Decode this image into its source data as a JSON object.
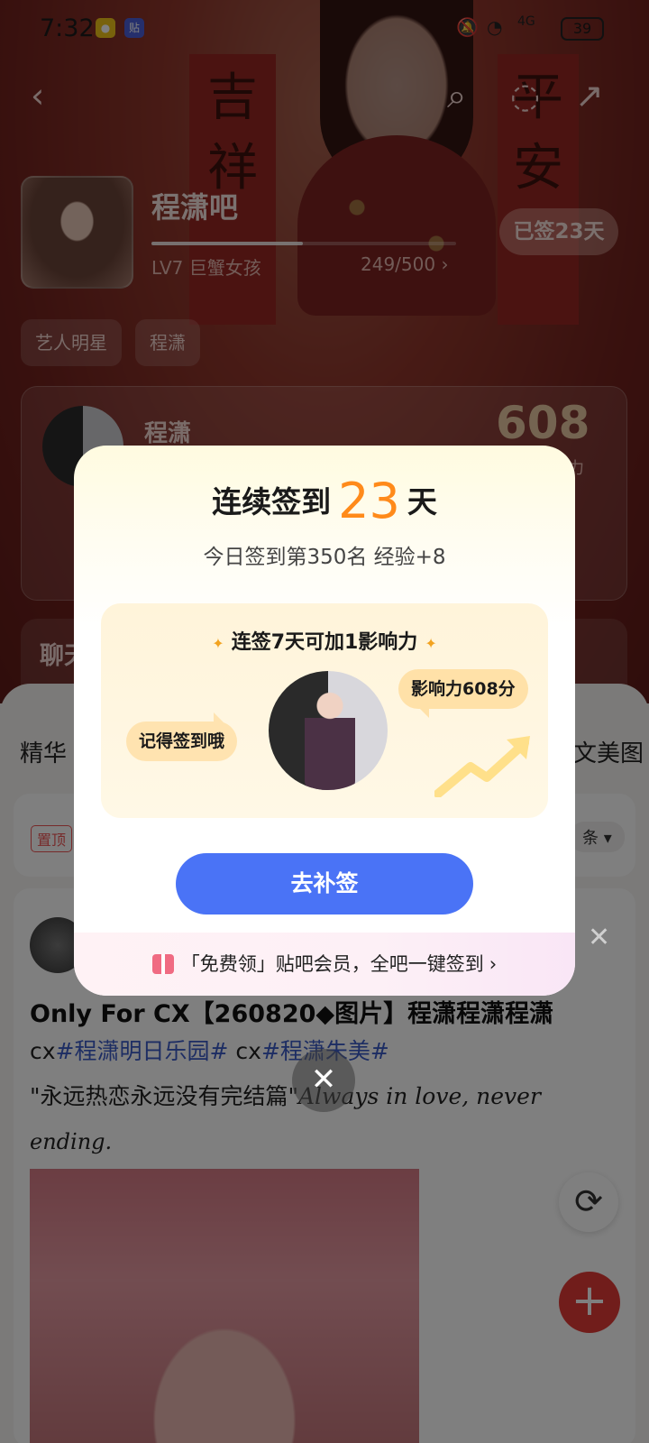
{
  "status_bar": {
    "time": "7:32",
    "battery": "39",
    "signal": "4G"
  },
  "forum": {
    "name": "程潇吧",
    "level": "LV7 巨蟹女孩",
    "exp": "249/500",
    "exp_progress": 0.498,
    "signed_badge": "已签23天",
    "tags": [
      "艺人明星",
      "程潇"
    ]
  },
  "star_card": {
    "name": "程潇",
    "score": "608",
    "sub": "力"
  },
  "chat_card": {
    "title": "聊天"
  },
  "tabs": {
    "left": "精华",
    "right": "美文美图"
  },
  "pin": {
    "badge": "置顶",
    "sort": "条"
  },
  "post": {
    "title": "Only For CX【260820◆图片】程潇程潇程潇",
    "line1_prefix": "cx",
    "topic1": "#程潇明日乐园#",
    "line1_mid": " cx",
    "topic2": "#程潇朱美#",
    "line2": "\"永远热恋永远没有完结篇\"",
    "line2_italic": "Always in love, never",
    "line3_italic": "ending."
  },
  "dialog": {
    "title_prefix": "连续签到",
    "days": "23",
    "title_suffix": "天",
    "subtitle": "今日签到第350名 经验+8",
    "panel_title": "连签7天可加1影响力",
    "bubble_left": "记得签到哦",
    "bubble_right": "影响力608分",
    "button": "去补签",
    "footer": "「免费领」贴吧会员，全吧一键签到",
    "footer_chevron": "›"
  },
  "colors": {
    "accent_orange": "#ff8a1a",
    "button_blue": "#4a73f6",
    "fab_red": "#e33a37",
    "topic_blue": "#3a5bc7"
  },
  "icons": [
    "back-icon",
    "search-icon",
    "chat-icon",
    "share-icon",
    "gift-icon",
    "close-icon",
    "refresh-icon",
    "plus-icon"
  ]
}
